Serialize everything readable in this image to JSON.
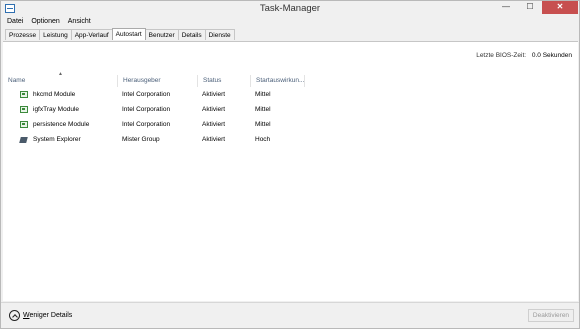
{
  "window": {
    "title": "Task-Manager"
  },
  "titlebar": {
    "minimize": "—",
    "maximize": "☐",
    "close": "✕"
  },
  "menu": [
    "Datei",
    "Optionen",
    "Ansicht"
  ],
  "tabs": [
    "Prozesse",
    "Leistung",
    "App-Verlauf",
    "Autostart",
    "Benutzer",
    "Details",
    "Dienste"
  ],
  "active_tab": "Autostart",
  "bios": {
    "label": "Letzte BIOS-Zeit:",
    "value": "0.0 Sekunden"
  },
  "columns": {
    "name": "Name",
    "publisher": "Herausgeber",
    "status": "Status",
    "impact": "Startauswirkun..."
  },
  "sort_indicator": "▲",
  "rows": [
    {
      "icon": "module-icon",
      "name": "hkcmd Module",
      "publisher": "Intel Corporation",
      "status": "Aktiviert",
      "impact": "Mittel"
    },
    {
      "icon": "module-icon",
      "name": "igfxTray Module",
      "publisher": "Intel Corporation",
      "status": "Aktiviert",
      "impact": "Mittel"
    },
    {
      "icon": "module-icon",
      "name": "persistence Module",
      "publisher": "Intel Corporation",
      "status": "Aktiviert",
      "impact": "Mittel"
    },
    {
      "icon": "system-explorer-icon",
      "name": "System Explorer",
      "publisher": "Mister Group",
      "status": "Aktiviert",
      "impact": "Hoch"
    }
  ],
  "footer": {
    "fewer_details_underline": "W",
    "fewer_details_rest": "eniger Details",
    "disable": "Deaktivieren"
  }
}
